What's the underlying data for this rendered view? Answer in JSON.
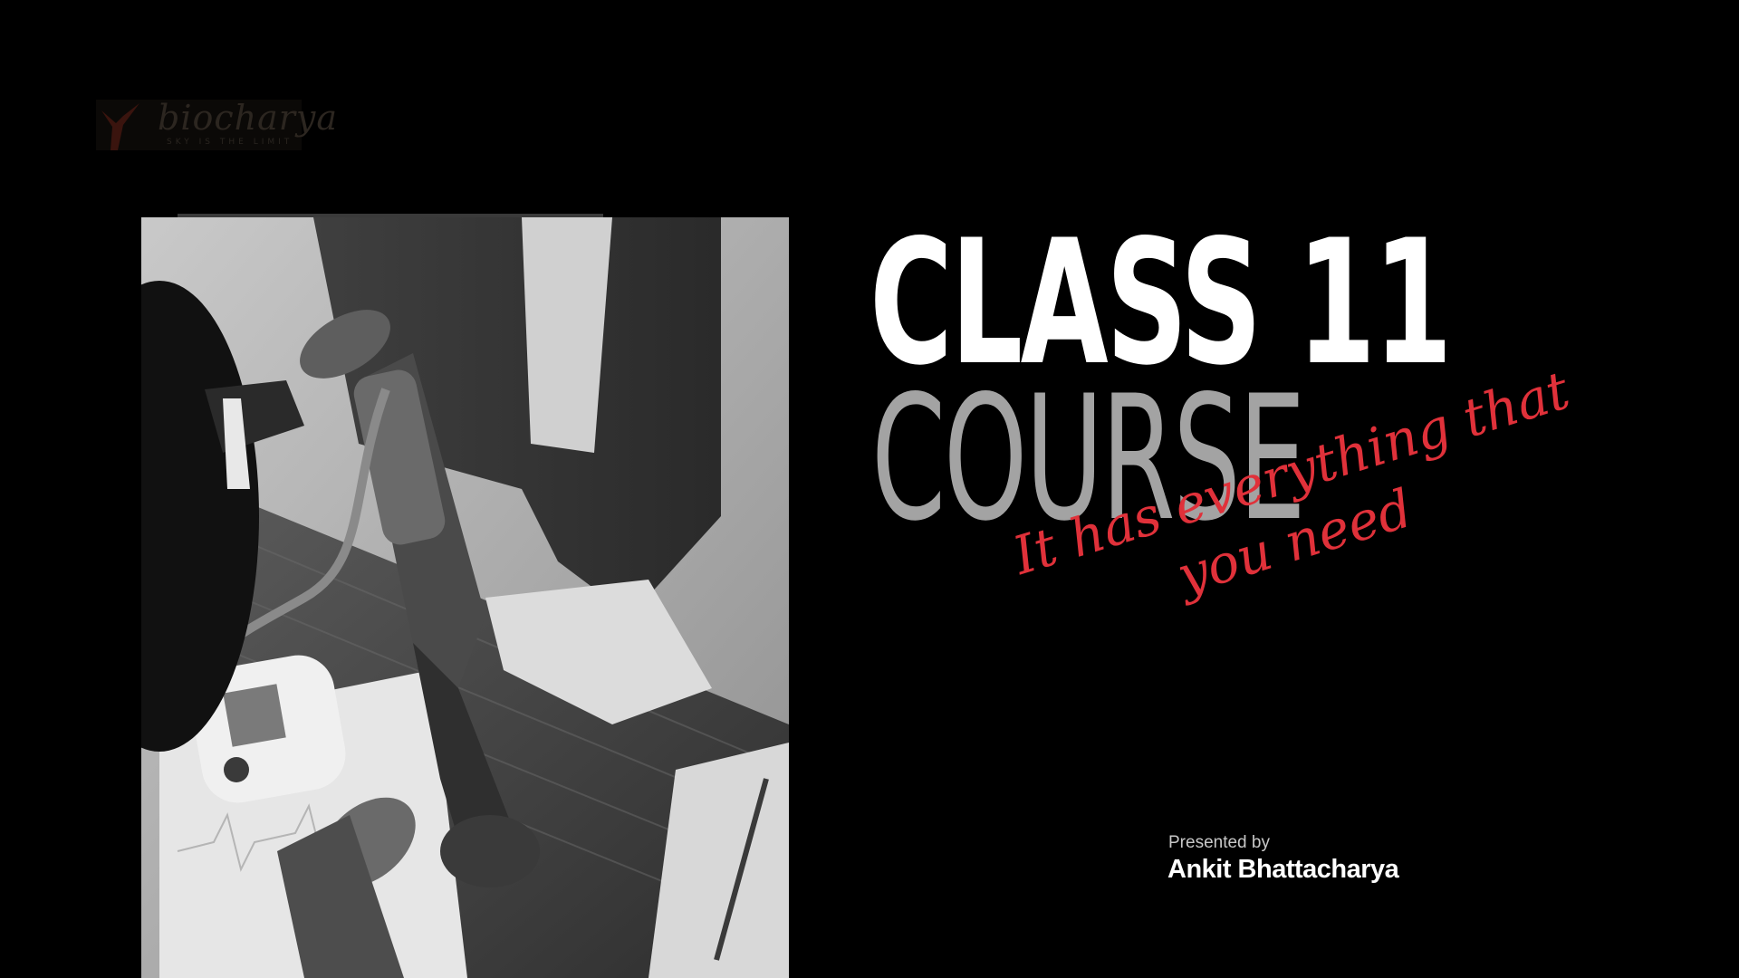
{
  "slide": {
    "background_color": "#000000",
    "logo": {
      "brand": "biocharya",
      "tagline": "SKY IS THE LIMIT",
      "icon": "red-check-mark-logo-icon"
    },
    "photo": {
      "icon": "blood-pressure-check-photo"
    },
    "headline": {
      "line1": "CLASS 11",
      "line2": "COURSE",
      "line1_color": "#ffffff",
      "line2_color": "#a3a3a3"
    },
    "script_tagline": {
      "line1": "It has everything that",
      "line2": "you need",
      "color": "#e0313a"
    },
    "presenter": {
      "label": "Presented by",
      "name": "Ankit Bhattacharya"
    }
  }
}
